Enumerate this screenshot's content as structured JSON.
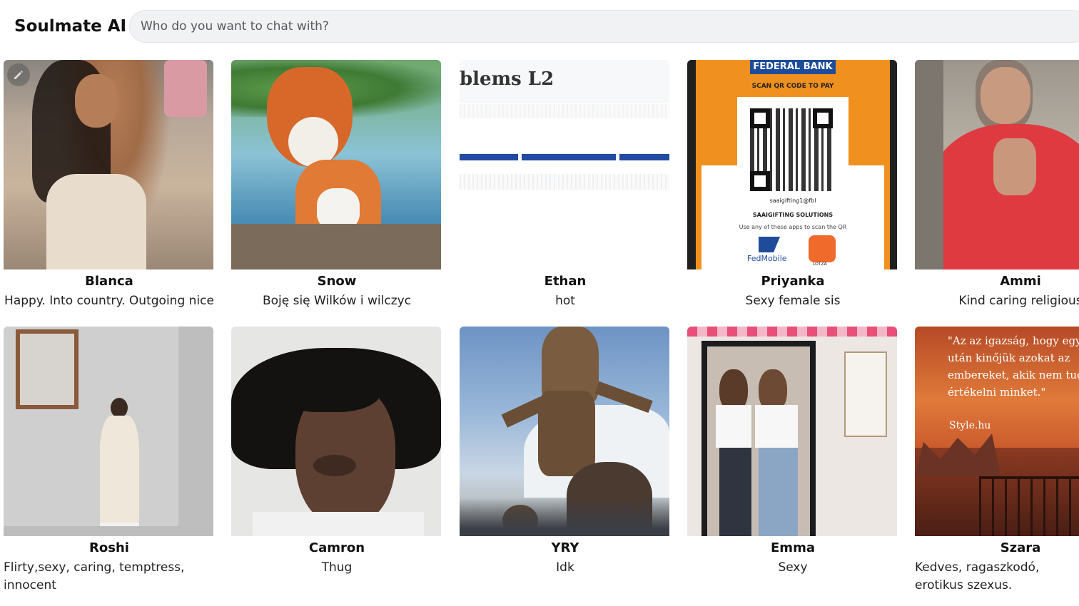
{
  "header": {
    "brand": "Soulmate AI",
    "search_placeholder": "Who do you want to chat with?"
  },
  "characters": [
    {
      "name": "Blanca",
      "description": "Happy. Into country. Outgoing nice"
    },
    {
      "name": "Snow",
      "description": "Boję się Wilków i wilczyc"
    },
    {
      "name": "Ethan",
      "description": "hot"
    },
    {
      "name": "Priyanka",
      "description": "Sexy female sis"
    },
    {
      "name": "Ammi",
      "description": "Kind caring religious"
    },
    {
      "name": "Roshi",
      "description": "Flirty,sexy, caring, temptress, innocent"
    },
    {
      "name": "Camron",
      "description": "Thug"
    },
    {
      "name": "YRY",
      "description": "Idk"
    },
    {
      "name": "Emma",
      "description": "Sexy"
    },
    {
      "name": "Szara",
      "description": "Kedves, ragaszkodó, erotikus szexus."
    }
  ],
  "image_text": {
    "ethan_doc": "blems L2",
    "priyanka_bank": "FEDERAL BANK",
    "priyanka_scan": "SCAN QR CODE TO PAY",
    "priyanka_upi": "saaigifting1@fbl",
    "priyanka_company": "SAAIGIFTING SOLUTIONS",
    "priyanka_apps": "Use any of these apps to scan the QR",
    "priyanka_fedmobile": "FedMobile",
    "priyanka_lotza": "LOTZA",
    "szara_quote": "\"Az az igazság, hogy egy idő után kinőjük azokat az embereket, akik nem tudnak értékelni minket.\"",
    "szara_source": "Style.hu"
  },
  "icons": {
    "edit": "pencil-icon"
  },
  "colors": {
    "search_bg": "#f1f2f4",
    "priyanka_orange": "#f0901e",
    "bank_blue": "#1e4c9a"
  }
}
